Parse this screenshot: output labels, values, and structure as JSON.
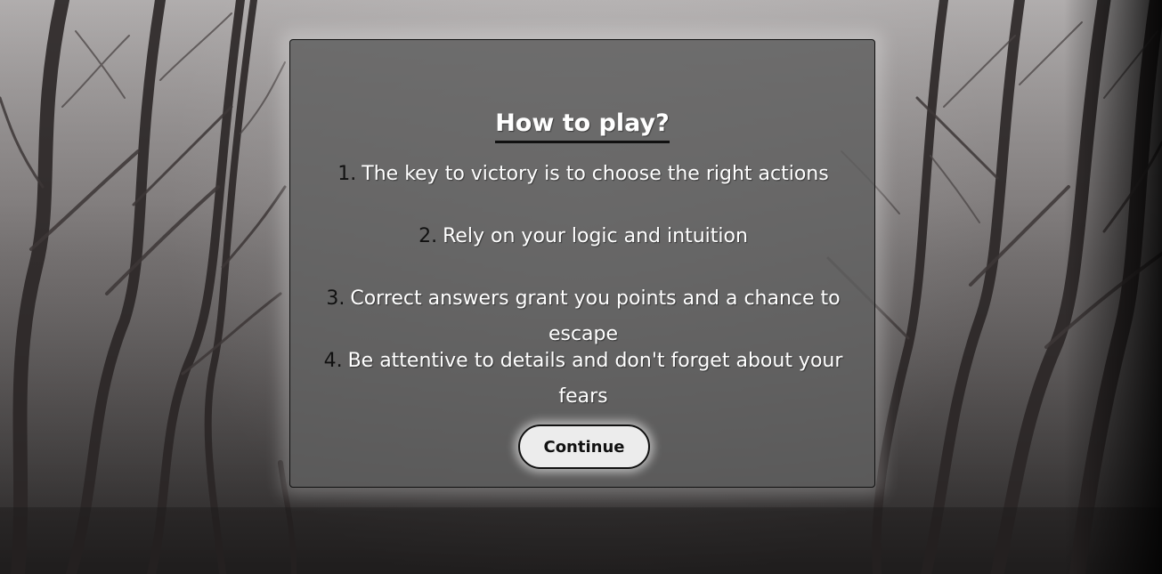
{
  "modal": {
    "title": "How to play?",
    "rules": [
      {
        "number": "1.",
        "text": "The key to victory is to choose the right actions"
      },
      {
        "number": "2.",
        "text": "Rely on your logic and intuition"
      },
      {
        "number": "3.",
        "text": "Correct answers grant you points and a chance to escape"
      },
      {
        "number": "4.",
        "text": "Be attentive to details and don't forget about your fears"
      }
    ],
    "continue_label": "Continue"
  },
  "colors": {
    "panel": "#606060",
    "button": "#ececec",
    "text": "#ffffff",
    "accent": "#111111"
  }
}
